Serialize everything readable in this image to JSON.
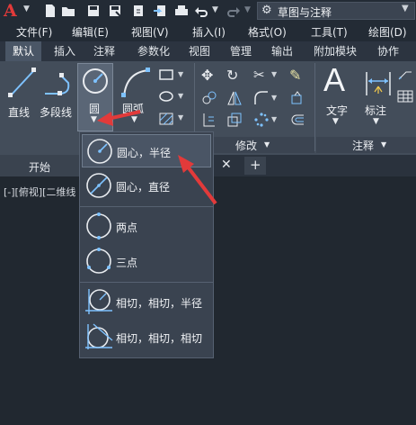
{
  "quick_access": {
    "logo": "A",
    "workspace": "草图与注释"
  },
  "menu": [
    "文件(F)",
    "编辑(E)",
    "视图(V)",
    "插入(I)",
    "格式(O)",
    "工具(T)",
    "绘图(D)"
  ],
  "ribbon_tabs": [
    "默认",
    "插入",
    "注释",
    "参数化",
    "视图",
    "管理",
    "输出",
    "附加模块",
    "协作"
  ],
  "ribbon": {
    "line": "直线",
    "polyline": "多段线",
    "circle": "圆",
    "arc": "圆弧",
    "text": "文字",
    "dimension": "标注",
    "modify_panel": "修改",
    "annotation_panel": "注释"
  },
  "file_tabs": {
    "start": "开始"
  },
  "viewport_label": "[-][俯视][二维线",
  "circle_menu": [
    "圆心，半径",
    "圆心，直径",
    "两点",
    "三点",
    "相切，相切，半径",
    "相切，相切，相切"
  ],
  "colors": {
    "accent_red": "#e23a3a",
    "highlight": "#4a5565",
    "icon_blue": "#7ec2ff"
  }
}
